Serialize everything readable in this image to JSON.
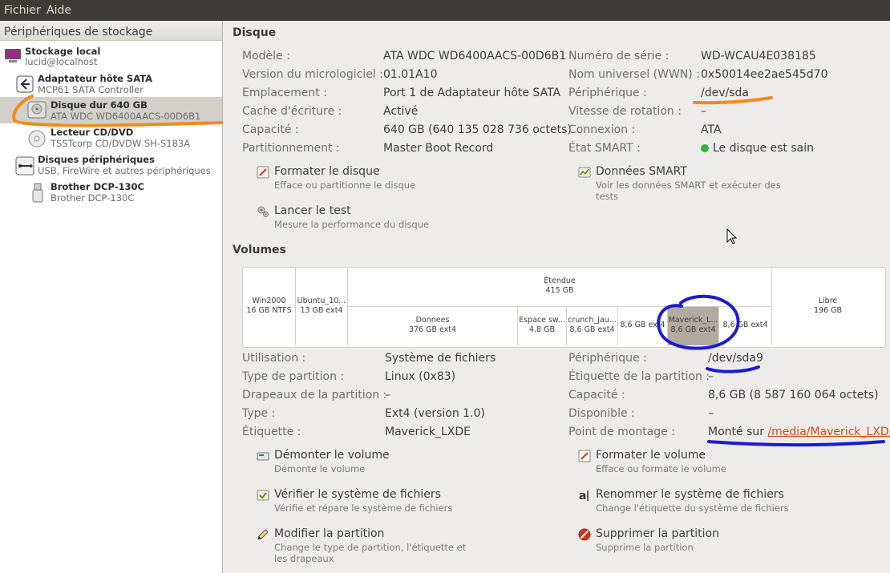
{
  "menubar": {
    "file": "Fichier",
    "help": "Aide"
  },
  "sidebar": {
    "header": "Périphériques de stockage",
    "items": [
      {
        "title": "Stockage local",
        "subtitle": "lucid@localhost"
      },
      {
        "title": "Adaptateur hôte SATA",
        "subtitle": "MCP61 SATA Controller"
      },
      {
        "title": "Disque dur 640 GB",
        "subtitle": "ATA WDC WD6400AACS-00D6B1"
      },
      {
        "title": "Lecteur CD/DVD",
        "subtitle": "TSSTcorp CD/DVDW SH-S183A"
      },
      {
        "title": "Disques périphériques",
        "subtitle": "USB, FireWire et autres périphériques"
      },
      {
        "title": "Brother DCP-130C",
        "subtitle": "Brother DCP-130C"
      }
    ]
  },
  "disk": {
    "title": "Disque",
    "left": [
      {
        "label": "Modèle :",
        "value": "ATA WDC WD6400AACS-00D6B1"
      },
      {
        "label": "Version du micrologiciel :",
        "value": "01.01A10"
      },
      {
        "label": "Emplacement :",
        "value": "Port 1 de Adaptateur hôte SATA"
      },
      {
        "label": "Cache d'écriture :",
        "value": "Activé"
      },
      {
        "label": "Capacité :",
        "value": "640 GB (640 135 028 736 octets)"
      },
      {
        "label": "Partitionnement :",
        "value": "Master Boot Record"
      }
    ],
    "right": [
      {
        "label": "Numéro de série :",
        "value": "WD-WCAU4E038185"
      },
      {
        "label": "Nom universel (WWN) :",
        "value": "0x50014ee2ae545d70"
      },
      {
        "label": "Périphérique :",
        "value": "/dev/sda"
      },
      {
        "label": "Vitesse de rotation :",
        "value": "–"
      },
      {
        "label": "Connexion :",
        "value": "ATA"
      },
      {
        "label": "État SMART :",
        "value": "Le disque est sain"
      }
    ],
    "actions": {
      "format": {
        "title": "Formater le disque",
        "desc": "Efface ou partitionne le disque"
      },
      "smart": {
        "title": "Données SMART",
        "desc": "Voir les données SMART et exécuter des tests"
      },
      "test": {
        "title": "Lancer le test",
        "desc": "Mesure la performance du disque"
      }
    }
  },
  "volumes": {
    "title": "Volumes",
    "map": {
      "win2000": {
        "name": "Win2000",
        "size": "16 GB NTFS"
      },
      "ubuntu": {
        "name": "Ubuntu_10...",
        "size": "13 GB ext4"
      },
      "extended": {
        "name": "Étendue",
        "size": "415 GB"
      },
      "free": {
        "name": "Libre",
        "size": "196 GB"
      },
      "donnees": {
        "name": "Donnees",
        "size": "376 GB ext4"
      },
      "swap": {
        "name": "Espace sw...",
        "size": "4,8 GB"
      },
      "crunch": {
        "name": "crunch_jau...",
        "size": "8,6 GB ext4"
      },
      "p8": {
        "size": "8,6 GB ext4"
      },
      "maverick": {
        "name": "Maverick_L...",
        "size": "8,6 GB ext4"
      },
      "p10": {
        "size": "8,6 GB ext4"
      }
    },
    "left": [
      {
        "label": "Utilisation :",
        "value": "Système de fichiers"
      },
      {
        "label": "Type de partition :",
        "value": "Linux (0x83)"
      },
      {
        "label": "Drapeaux de la partition :",
        "value": "–"
      },
      {
        "label": "Type :",
        "value": "Ext4 (version 1.0)"
      },
      {
        "label": "Étiquette :",
        "value": "Maverick_LXDE"
      }
    ],
    "right": [
      {
        "label": "Périphérique :",
        "value": "/dev/sda9"
      },
      {
        "label": "Étiquette de la partition :",
        "value": "–"
      },
      {
        "label": "Capacité :",
        "value": "8,6 GB (8 587 160 064 octets)"
      },
      {
        "label": "Disponible :",
        "value": "–"
      },
      {
        "label": "Point de montage :",
        "prefix": "Monté sur ",
        "value": "/media/Maverick_LXDE"
      }
    ],
    "actions": {
      "unmount": {
        "title": "Démonter le volume",
        "desc": "Démonte le volume"
      },
      "formatvol": {
        "title": "Formater le volume",
        "desc": "Efface ou formate le volume"
      },
      "check": {
        "title": "Vérifier le système de fichiers",
        "desc": "Vérifie et répare le système de fichiers"
      },
      "rename": {
        "title": "Renommer le système de fichiers",
        "desc": "Change l'étiquette du système de fichiers"
      },
      "edit": {
        "title": "Modifier la partition",
        "desc": "Change le type de partition, l'étiquette et les drapeaux"
      },
      "delete": {
        "title": "Supprimer la partition",
        "desc": "Supprime la partition"
      }
    }
  },
  "colors": {
    "menubar": "#3c3b37",
    "selection": "#d3d0ca",
    "annotation_orange": "#f28a1c",
    "annotation_blue": "#1a1ad6",
    "link": "#d14a1a",
    "status_ok": "#33b23d"
  }
}
